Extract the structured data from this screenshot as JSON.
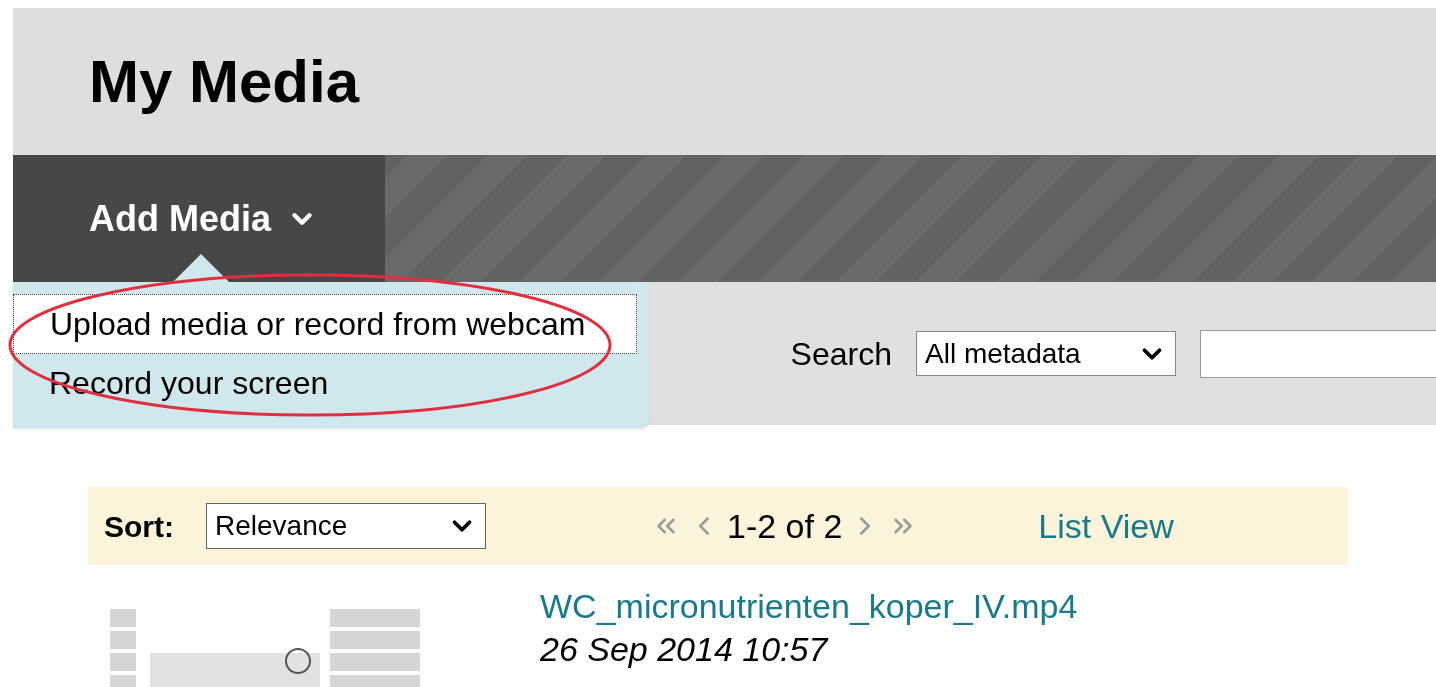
{
  "header": {
    "title": "My Media"
  },
  "add_media": {
    "label": "Add Media",
    "expanded": true,
    "menu": [
      {
        "label": "Upload media or record from webcam",
        "selected": true
      },
      {
        "label": "Record your screen",
        "selected": false
      }
    ]
  },
  "search": {
    "label": "Search",
    "scope": "All metadata"
  },
  "sort_bar": {
    "label": "Sort:",
    "value": "Relevance",
    "pager": "1-2 of 2",
    "view_link": "List View"
  },
  "media": [
    {
      "title": "WC_micronutrienten_koper_IV.mp4",
      "date": "26 Sep 2014 10:57",
      "kind": "picture"
    }
  ]
}
